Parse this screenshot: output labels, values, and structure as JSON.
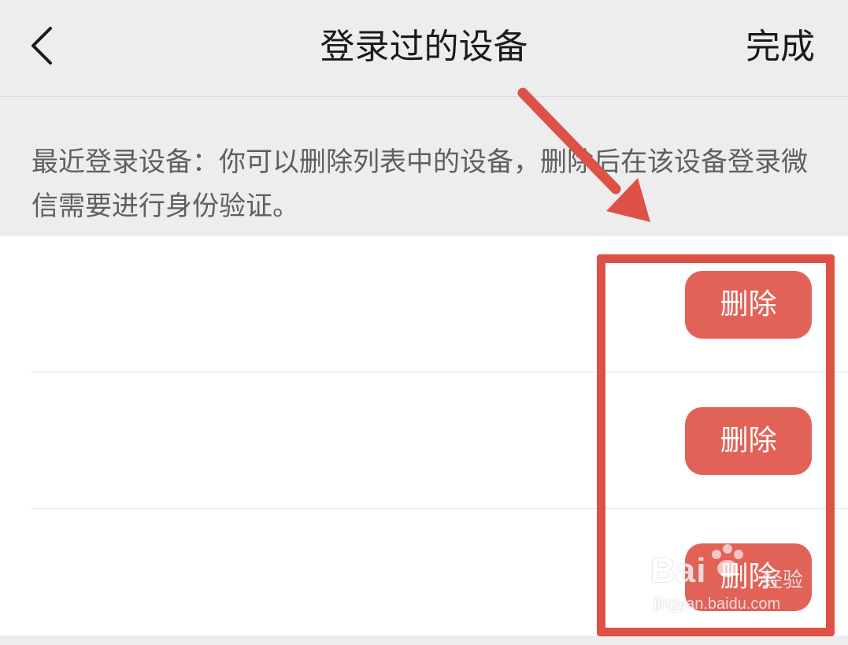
{
  "nav": {
    "title": "登录过的设备",
    "done_label": "完成",
    "back_icon": "chevron-left-icon"
  },
  "hint": {
    "text": "最近登录设备：你可以删除列表中的设备，删除后在该设备登录微信需要进行身份验证。"
  },
  "devices": [
    {
      "name": "",
      "delete_label": "删除"
    },
    {
      "name": "",
      "delete_label": "删除"
    },
    {
      "name": "",
      "delete_label": "删除"
    }
  ],
  "annotation": {
    "arrow_color": "#dd5146",
    "box_color": "#dd5146"
  },
  "colors": {
    "background": "#ededed",
    "list_background": "#ffffff",
    "delete_button": "#e36257",
    "title_text": "#1a1a1a",
    "hint_text": "#5f5f5f"
  },
  "watermark": {
    "brand": "Bai",
    "sub": "经验",
    "url": "jingyan.baidu.com"
  }
}
